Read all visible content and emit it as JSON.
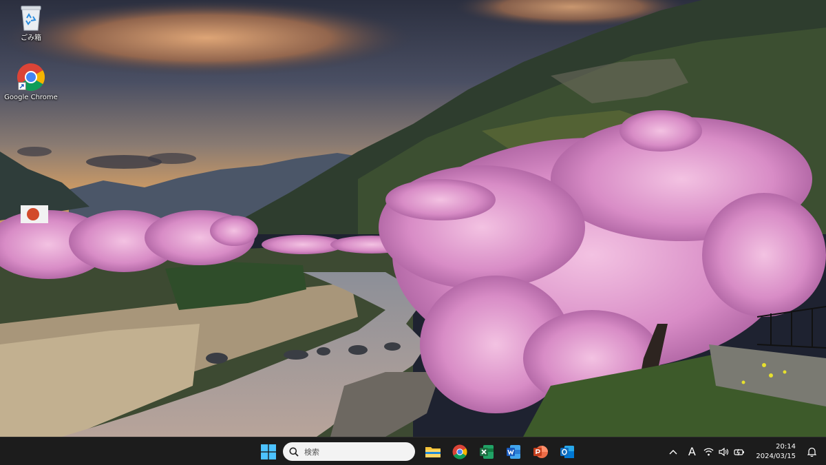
{
  "desktop": {
    "icons": [
      {
        "label": "ごみ箱",
        "icon": "recycle-bin-icon"
      },
      {
        "label": "Google Chrome",
        "icon": "chrome-icon"
      }
    ]
  },
  "taskbar": {
    "start_icon": "windows-logo-icon",
    "search": {
      "placeholder": "検索",
      "icon": "search-icon"
    },
    "pinned_apps": [
      {
        "name": "File Explorer",
        "icon": "folder-icon"
      },
      {
        "name": "Google Chrome",
        "icon": "chrome-icon"
      },
      {
        "name": "Excel",
        "icon": "excel-icon",
        "color": "#1d6f42"
      },
      {
        "name": "Word",
        "icon": "word-icon",
        "color": "#185abd"
      },
      {
        "name": "PowerPoint",
        "icon": "powerpoint-icon",
        "color": "#c43e1c"
      },
      {
        "name": "Outlook",
        "icon": "outlook-icon",
        "color": "#0f6cbd"
      }
    ],
    "tray": {
      "ime_indicator": "A",
      "time": "20:14",
      "date": "2024/03/15"
    }
  },
  "colors": {
    "taskbar_bg": "#1c1c1c",
    "search_bg": "#f3f3f3",
    "accent": "#0078d4"
  }
}
